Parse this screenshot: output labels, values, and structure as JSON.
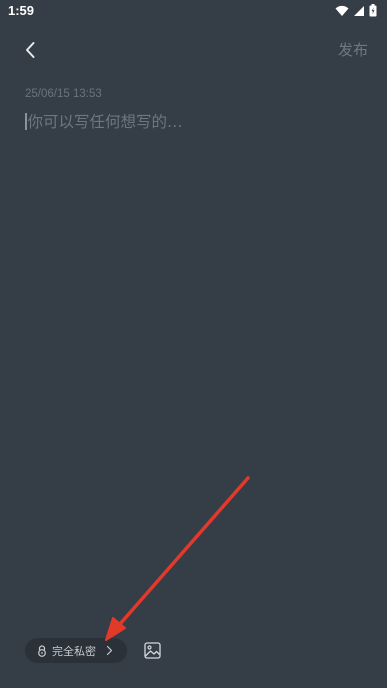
{
  "status_bar": {
    "time": "1:59"
  },
  "header": {
    "publish_label": "发布"
  },
  "editor": {
    "timestamp": "25/06/15 13:53",
    "placeholder": "你可以写任何想写的…"
  },
  "toolbar": {
    "privacy_label": "完全私密"
  },
  "colors": {
    "background": "#353d46",
    "annotation_arrow": "#e2392b"
  },
  "icons": {
    "back": "back-arrow-icon",
    "lock": "lock-icon",
    "chevron": "chevron-right-icon",
    "image": "image-icon",
    "wifi": "wifi-icon",
    "signal": "signal-icon",
    "battery": "battery-icon"
  }
}
